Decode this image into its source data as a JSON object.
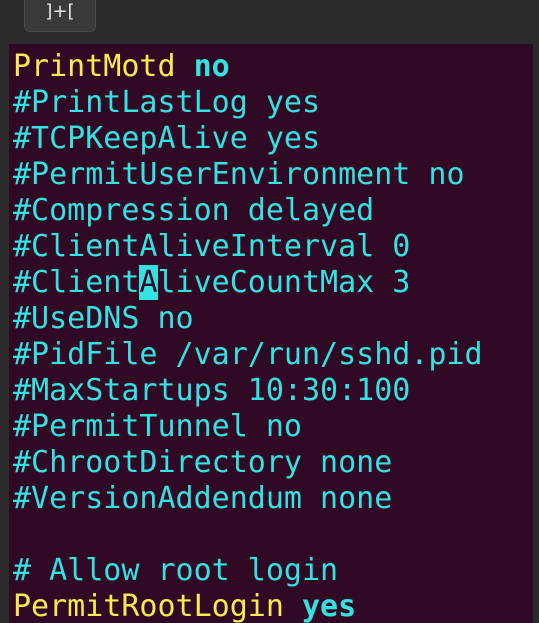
{
  "window": {
    "tab_button_label": "]+["
  },
  "terminal": {
    "lines": {
      "l0": {
        "key": "PrintMotd",
        "sep": " ",
        "value": "no"
      },
      "l1": "#PrintLastLog yes",
      "l2": "#TCPKeepAlive yes",
      "l3": "#PermitUserEnvironment no",
      "l4": "#Compression delayed",
      "l5": "#ClientAliveInterval 0",
      "l6": {
        "before": "#Client",
        "cursor": "A",
        "after": "liveCountMax 3"
      },
      "l7": "#UseDNS no",
      "l8": "#PidFile /var/run/sshd.pid",
      "l9": "#MaxStartups 10:30:100",
      "l10": "#PermitTunnel no",
      "l11": "#ChrootDirectory none",
      "l12": "#VersionAddendum none",
      "l13": "",
      "l14": "# Allow root login",
      "l15": {
        "key": "PermitRootLogin",
        "sep": " ",
        "value": "yes"
      }
    }
  },
  "colors": {
    "background": "#300a24",
    "comment": "#34e2e2",
    "keyword": "#fce94f",
    "cursor": "#34e2e2"
  }
}
